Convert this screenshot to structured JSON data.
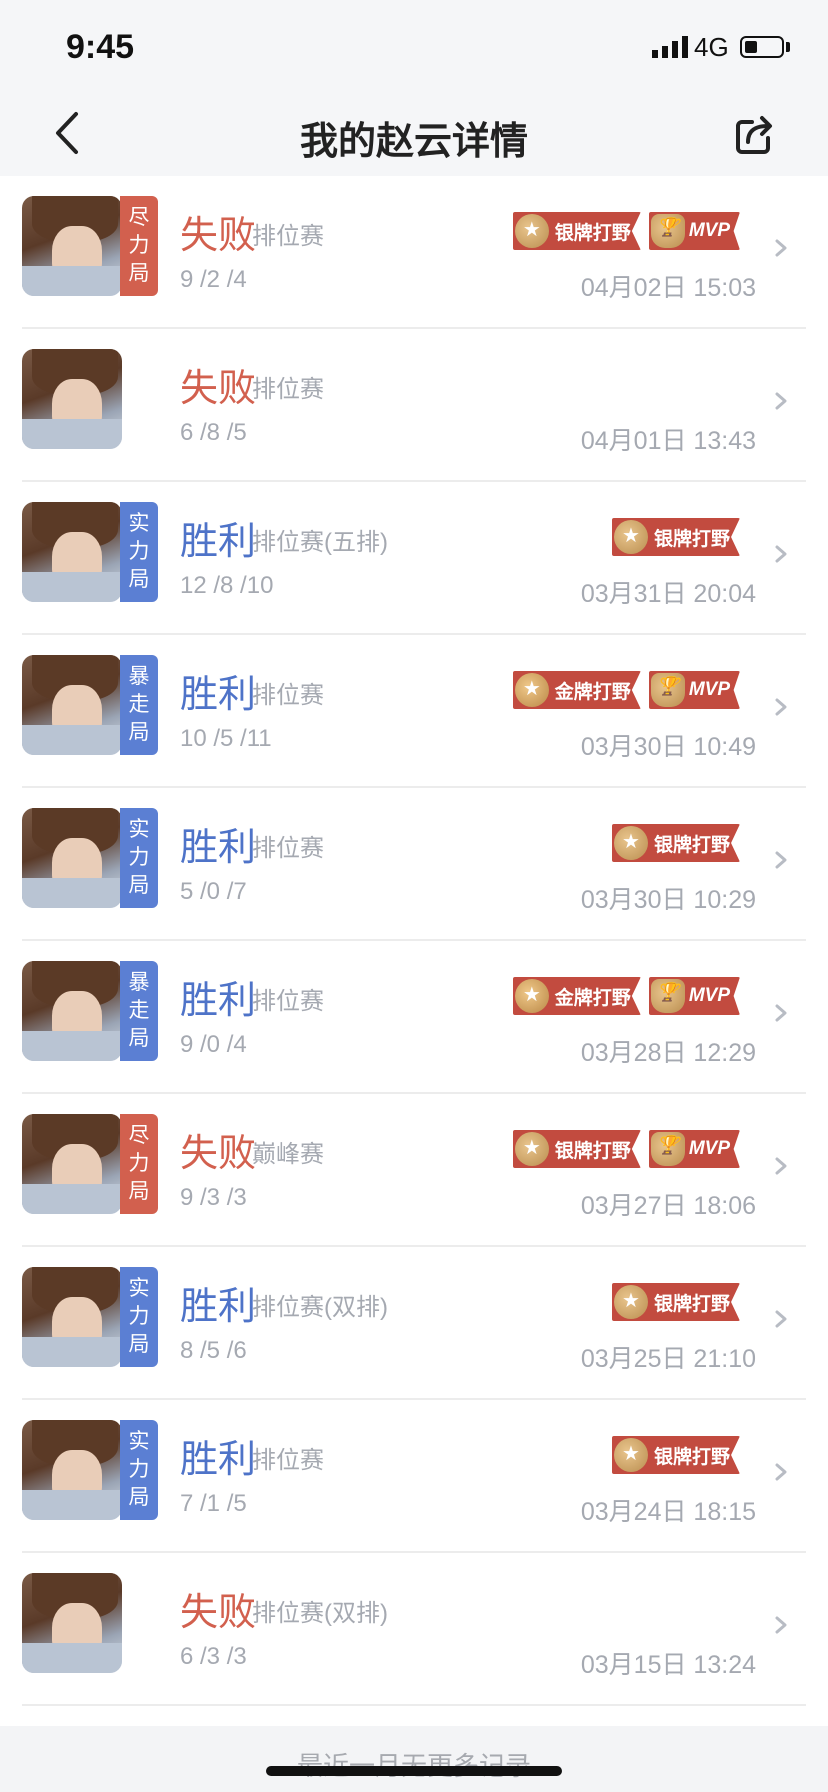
{
  "status_bar": {
    "time": "9:45",
    "network": "4G"
  },
  "nav": {
    "title": "我的赵云详情"
  },
  "matches": [
    {
      "tag": "尽力局",
      "tag_color": "#d2604e",
      "result": "失败",
      "outcome": "lose",
      "mode": "排位赛",
      "kda": "9 /2 /4",
      "datetime": "04月02日 15:03",
      "badges": [
        {
          "label": "银牌打野",
          "kind": "silver"
        },
        {
          "label": "MVP",
          "kind": "mvp"
        }
      ]
    },
    {
      "tag": "",
      "tag_color": "",
      "result": "失败",
      "outcome": "lose",
      "mode": "排位赛",
      "kda": "6 /8 /5",
      "datetime": "04月01日 13:43",
      "badges": []
    },
    {
      "tag": "实力局",
      "tag_color": "#5b7fd3",
      "result": "胜利",
      "outcome": "win",
      "mode": "排位赛(五排)",
      "kda": "12 /8 /10",
      "datetime": "03月31日 20:04",
      "badges": [
        {
          "label": "银牌打野",
          "kind": "silver"
        }
      ]
    },
    {
      "tag": "暴走局",
      "tag_color": "#5b7fd3",
      "result": "胜利",
      "outcome": "win",
      "mode": "排位赛",
      "kda": "10 /5 /11",
      "datetime": "03月30日 10:49",
      "badges": [
        {
          "label": "金牌打野",
          "kind": "gold"
        },
        {
          "label": "MVP",
          "kind": "mvp"
        }
      ]
    },
    {
      "tag": "实力局",
      "tag_color": "#5b7fd3",
      "result": "胜利",
      "outcome": "win",
      "mode": "排位赛",
      "kda": "5 /0 /7",
      "datetime": "03月30日 10:29",
      "badges": [
        {
          "label": "银牌打野",
          "kind": "silver"
        }
      ]
    },
    {
      "tag": "暴走局",
      "tag_color": "#5b7fd3",
      "result": "胜利",
      "outcome": "win",
      "mode": "排位赛",
      "kda": "9 /0 /4",
      "datetime": "03月28日 12:29",
      "badges": [
        {
          "label": "金牌打野",
          "kind": "gold"
        },
        {
          "label": "MVP",
          "kind": "mvp"
        }
      ]
    },
    {
      "tag": "尽力局",
      "tag_color": "#d2604e",
      "result": "失败",
      "outcome": "lose",
      "mode": "巅峰赛",
      "kda": "9 /3 /3",
      "datetime": "03月27日 18:06",
      "badges": [
        {
          "label": "银牌打野",
          "kind": "silver"
        },
        {
          "label": "MVP",
          "kind": "mvp"
        }
      ]
    },
    {
      "tag": "实力局",
      "tag_color": "#5b7fd3",
      "result": "胜利",
      "outcome": "win",
      "mode": "排位赛(双排)",
      "kda": "8 /5 /6",
      "datetime": "03月25日 21:10",
      "badges": [
        {
          "label": "银牌打野",
          "kind": "silver"
        }
      ]
    },
    {
      "tag": "实力局",
      "tag_color": "#5b7fd3",
      "result": "胜利",
      "outcome": "win",
      "mode": "排位赛",
      "kda": "7 /1 /5",
      "datetime": "03月24日 18:15",
      "badges": [
        {
          "label": "银牌打野",
          "kind": "silver"
        }
      ]
    },
    {
      "tag": "",
      "tag_color": "",
      "result": "失败",
      "outcome": "lose",
      "mode": "排位赛(双排)",
      "kda": "6 /3 /3",
      "datetime": "03月15日 13:24",
      "badges": []
    }
  ],
  "footer": {
    "text": "最近一月无更多记录"
  }
}
